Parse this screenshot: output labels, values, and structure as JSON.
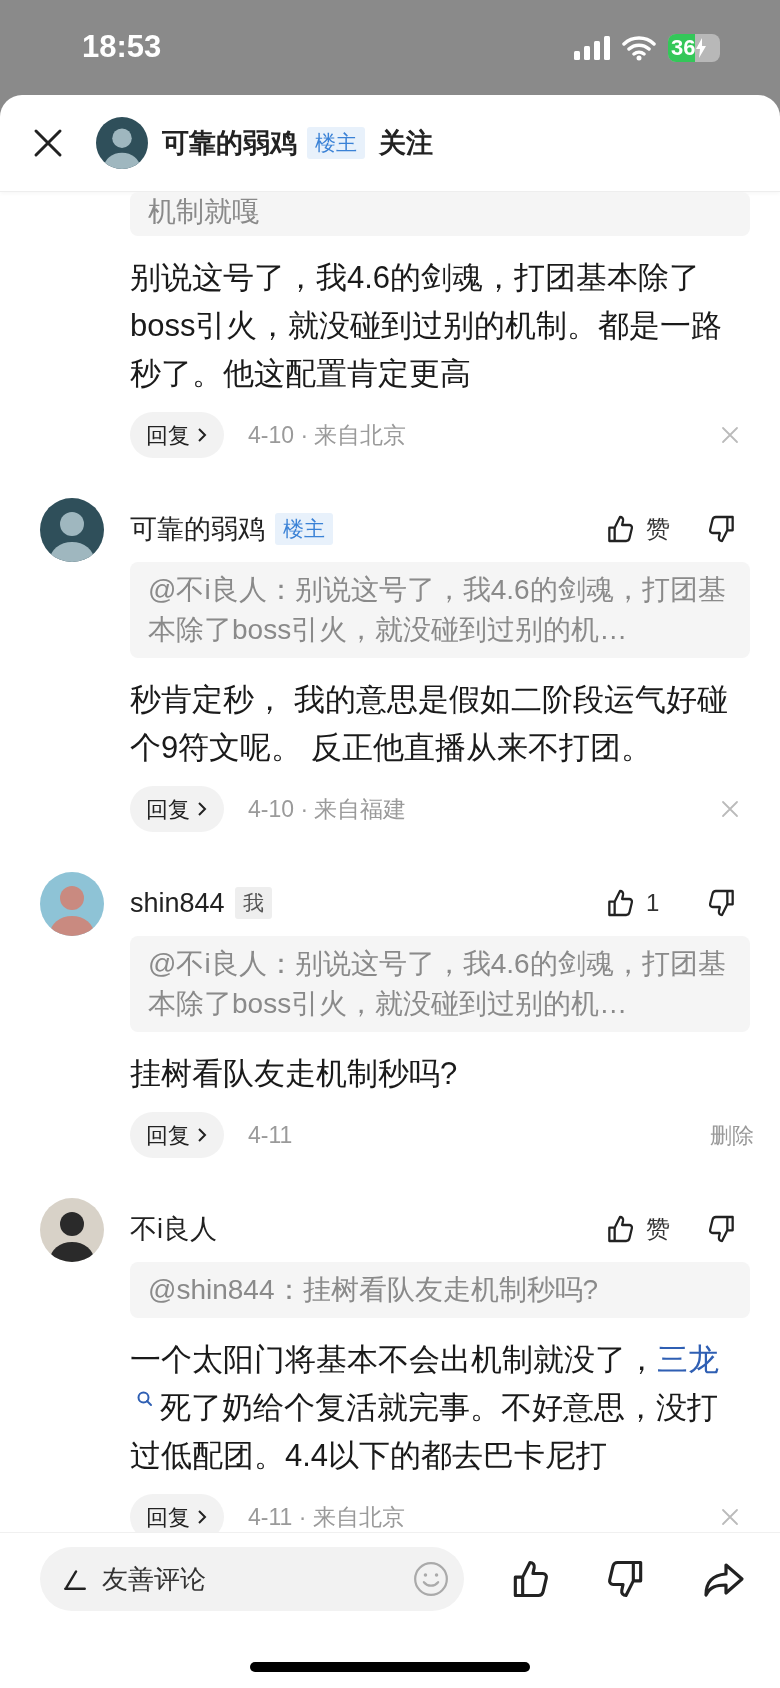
{
  "status_bar": {
    "time": "18:53",
    "battery": "36"
  },
  "header": {
    "author": "可靠的弱鸡",
    "badge": {
      "label": "楼主",
      "kind": "op"
    },
    "follow": "关注"
  },
  "comments": [
    {
      "quote": "机制就嘎",
      "segments": [
        {
          "kind": "plain",
          "text": "别说这号了，我4.6的剑魂，打团基本除了boss引火，就没碰到过别的机制。都是一路秒了。他这配置肯定更高"
        }
      ],
      "reply": "回复",
      "meta": "4-10 · 来自北京",
      "trailing": {
        "kind": "dismiss"
      }
    },
    {
      "author": "可靠的弱鸡",
      "badge": {
        "label": "楼主",
        "kind": "op"
      },
      "like": "赞",
      "quote": "@不i良人：别说这号了，我4.6的剑魂，打团基本除了boss引火，就没碰到过别的机…",
      "segments": [
        {
          "kind": "plain",
          "text": "秒肯定秒， 我的意思是假如二阶段运气好碰个9符文呢。 反正他直播从来不打团。"
        }
      ],
      "reply": "回复",
      "meta": "4-10 · 来自福建",
      "trailing": {
        "kind": "dismiss"
      }
    },
    {
      "author": "shin844",
      "badge": {
        "label": "我",
        "kind": "self"
      },
      "like": "1",
      "quote": "@不i良人：别说这号了，我4.6的剑魂，打团基本除了boss引火，就没碰到过别的机…",
      "segments": [
        {
          "kind": "plain",
          "text": "挂树看队友走机制秒吗?"
        }
      ],
      "reply": "回复",
      "meta": "4-11",
      "trailing": {
        "kind": "delete",
        "label": "删除"
      }
    },
    {
      "author": "不i良人",
      "like": "赞",
      "quote": "@shin844：挂树看队友走机制秒吗?",
      "segments": [
        {
          "kind": "plain",
          "text": "一个太阳门将基本不会出机制就没了，"
        },
        {
          "kind": "link",
          "text": "三龙"
        },
        {
          "kind": "plain",
          "text": "死了奶给个复活就完事。不好意思，没打过低配团。4.4以下的都去巴卡尼打"
        }
      ],
      "reply": "回复",
      "meta": "4-11 · 来自北京",
      "trailing": {
        "kind": "dismiss"
      }
    }
  ],
  "composer": {
    "placeholder": "友善评论"
  }
}
